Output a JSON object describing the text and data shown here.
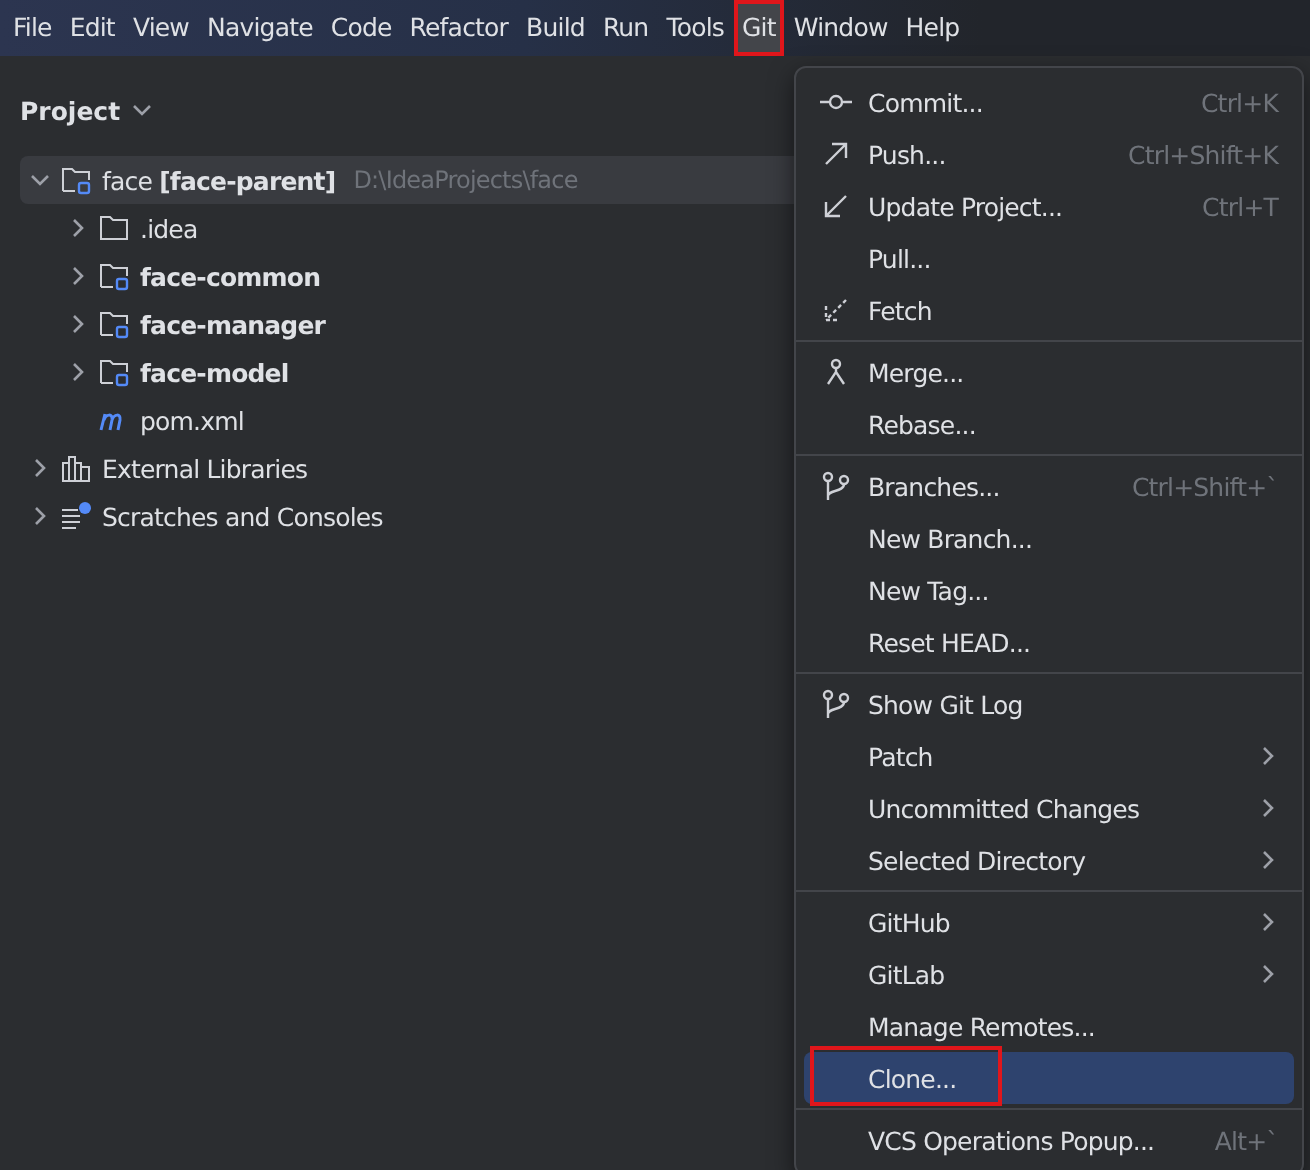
{
  "menu_bar": [
    {
      "label": "File",
      "selected": false
    },
    {
      "label": "Edit",
      "selected": false
    },
    {
      "label": "View",
      "selected": false
    },
    {
      "label": "Navigate",
      "selected": false
    },
    {
      "label": "Code",
      "selected": false
    },
    {
      "label": "Refactor",
      "selected": false
    },
    {
      "label": "Build",
      "selected": false
    },
    {
      "label": "Run",
      "selected": false
    },
    {
      "label": "Tools",
      "selected": false
    },
    {
      "label": "Git",
      "selected": true
    },
    {
      "label": "Window",
      "selected": false
    },
    {
      "label": "Help",
      "selected": false
    }
  ],
  "project_panel": {
    "title": "Project",
    "tree": [
      {
        "kind": "module",
        "label": "face **[face-parent]**",
        "path": "D:\\IdeaProjects\\face",
        "expanded": true,
        "selected": true,
        "children": [
          {
            "kind": "folder",
            "label": ".idea",
            "bold": false,
            "expanded": false,
            "selected": false
          },
          {
            "kind": "module",
            "label": "face-common",
            "bold": true,
            "expanded": false,
            "selected": false
          },
          {
            "kind": "module",
            "label": "face-manager",
            "bold": true,
            "expanded": false,
            "selected": false
          },
          {
            "kind": "module",
            "label": "face-model",
            "bold": true,
            "expanded": false,
            "selected": false
          },
          {
            "kind": "maven",
            "label": "pom.xml",
            "bold": false,
            "selected": false
          }
        ]
      },
      {
        "kind": "libraries",
        "label": "External Libraries",
        "expanded": false,
        "selected": false
      },
      {
        "kind": "scratches",
        "label": "Scratches and Consoles",
        "expanded": false,
        "selected": false
      }
    ]
  },
  "git_menu": [
    [
      {
        "kind": "commit",
        "label": "Commit...",
        "shortcut": "Ctrl+K",
        "submenu": false,
        "selected": false
      },
      {
        "kind": "push",
        "label": "Push...",
        "shortcut": "Ctrl+Shift+K",
        "submenu": false,
        "selected": false
      },
      {
        "kind": "update",
        "label": "Update Project...",
        "shortcut": "Ctrl+T",
        "submenu": false,
        "selected": false
      },
      {
        "kind": "plain",
        "label": "Pull...",
        "submenu": false,
        "selected": false
      },
      {
        "kind": "fetch",
        "label": "Fetch",
        "submenu": false,
        "selected": false
      }
    ],
    [
      {
        "kind": "merge",
        "label": "Merge...",
        "submenu": false,
        "selected": false
      },
      {
        "kind": "plain",
        "label": "Rebase...",
        "submenu": false,
        "selected": false
      }
    ],
    [
      {
        "kind": "branch",
        "label": "Branches...",
        "shortcut": "Ctrl+Shift+`",
        "submenu": false,
        "selected": false
      },
      {
        "kind": "plain",
        "label": "New Branch...",
        "submenu": false,
        "selected": false
      },
      {
        "kind": "plain",
        "label": "New Tag...",
        "submenu": false,
        "selected": false
      },
      {
        "kind": "plain",
        "label": "Reset HEAD...",
        "submenu": false,
        "selected": false
      }
    ],
    [
      {
        "kind": "branch",
        "label": "Show Git Log",
        "submenu": false,
        "selected": false
      },
      {
        "kind": "plain",
        "label": "Patch",
        "submenu": true,
        "selected": false
      },
      {
        "kind": "plain",
        "label": "Uncommitted Changes",
        "submenu": true,
        "selected": false
      },
      {
        "kind": "plain",
        "label": "Selected Directory",
        "submenu": true,
        "selected": false
      }
    ],
    [
      {
        "kind": "plain",
        "label": "GitHub",
        "submenu": true,
        "selected": false
      },
      {
        "kind": "plain",
        "label": "GitLab",
        "submenu": true,
        "selected": false
      },
      {
        "kind": "plain",
        "label": "Manage Remotes...",
        "submenu": false,
        "selected": false
      },
      {
        "kind": "plain",
        "label": "Clone...",
        "submenu": false,
        "selected": true
      }
    ],
    [
      {
        "kind": "plain",
        "label": "VCS Operations Popup...",
        "shortcut": "Alt+`",
        "submenu": false,
        "selected": false
      }
    ]
  ]
}
